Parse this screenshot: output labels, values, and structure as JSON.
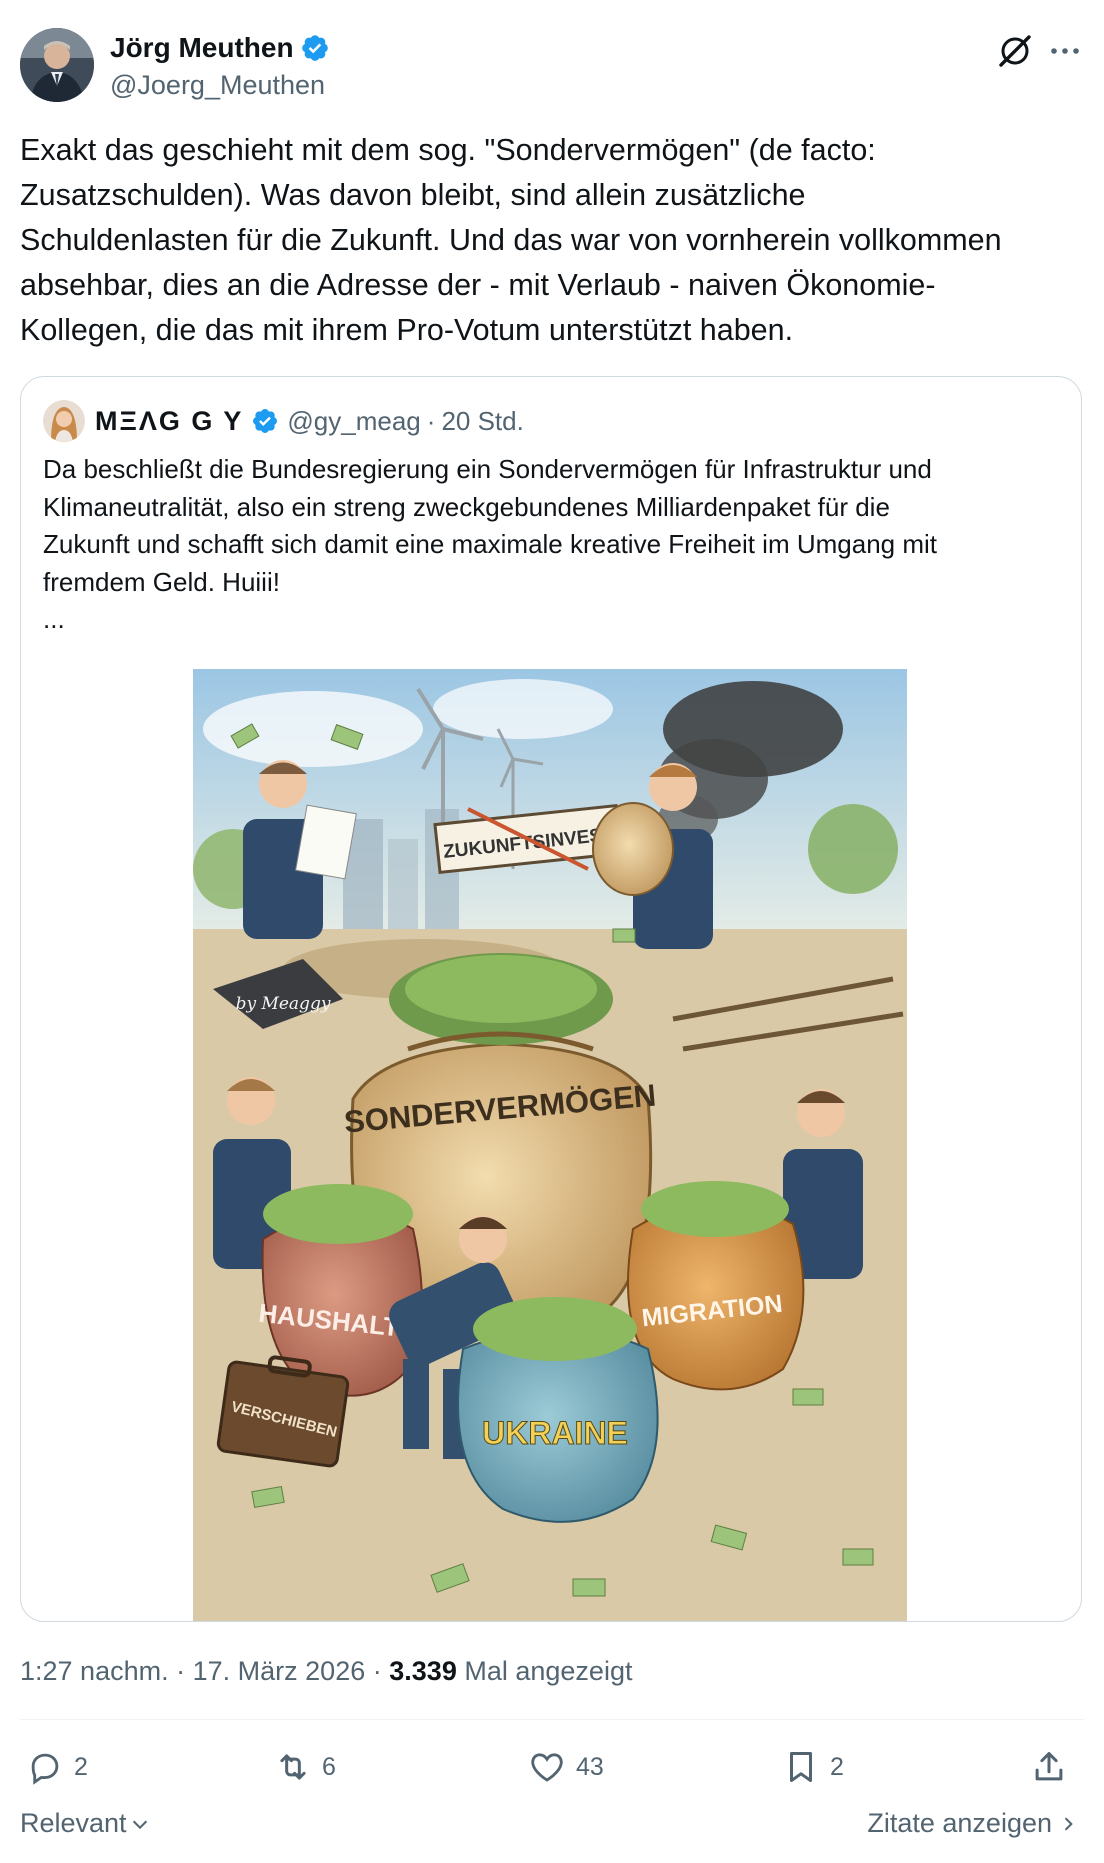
{
  "author": {
    "name": "Jörg Meuthen",
    "handle": "@Joerg_Meuthen",
    "verified": true,
    "verified_color": "#1d9bf0"
  },
  "header_icons": [
    "grok-icon",
    "more-icon"
  ],
  "tweet": {
    "text": "Exakt das geschieht mit dem sog. \"Sondervermögen\" (de facto:\nZusatzschulden). Was davon bleibt, sind allein zusätzliche\nSchuldenlasten für die Zukunft. Und das war von vornherein vollkommen\nabsehbar, dies an die Adresse der - mit Verlaub - naiven Ökonomie-\nKollegen, die das mit ihrem Pro-Votum unterstützt haben."
  },
  "quote": {
    "name": "MΞΛG G Y",
    "handle": "@gy_meag",
    "separator": "·",
    "time": "20 Std.",
    "text": "Da beschließt die Bundesregierung ein Sondervermögen für Infrastruktur und\nKlimaneutralität, also ein streng zweckgebundenes Milliardenpaket für die\nZukunft und schafft sich damit eine maximale kreative Freiheit im Umgang mit\nfremdem Geld. Huiii!\n...",
    "image": {
      "labels": {
        "sign": "ZUKUNFTSINVEST",
        "big_sack": "SONDERVERMÖGEN",
        "left_sack": "HAUSHALT",
        "right_sack": "MIGRATION",
        "front_sack": "UKRAINE",
        "suitcase": "VERSCHIEBEN",
        "signature": "by Meaggy"
      }
    }
  },
  "meta": {
    "time": "1:27 nachm.",
    "sep1": "·",
    "date": "17. März 2026",
    "sep2": "·",
    "views_count": "3.339",
    "views_label": "Mal angezeigt"
  },
  "actions": {
    "replies": "2",
    "reposts": "6",
    "likes": "43",
    "bookmarks": "2"
  },
  "bottom": {
    "sort_label": "Relevant",
    "quotes_label": "Zitate anzeigen"
  },
  "colors": {
    "text": "#0f1419",
    "secondary": "#536471",
    "border": "#cfd9de",
    "accent": "#1d9bf0"
  }
}
